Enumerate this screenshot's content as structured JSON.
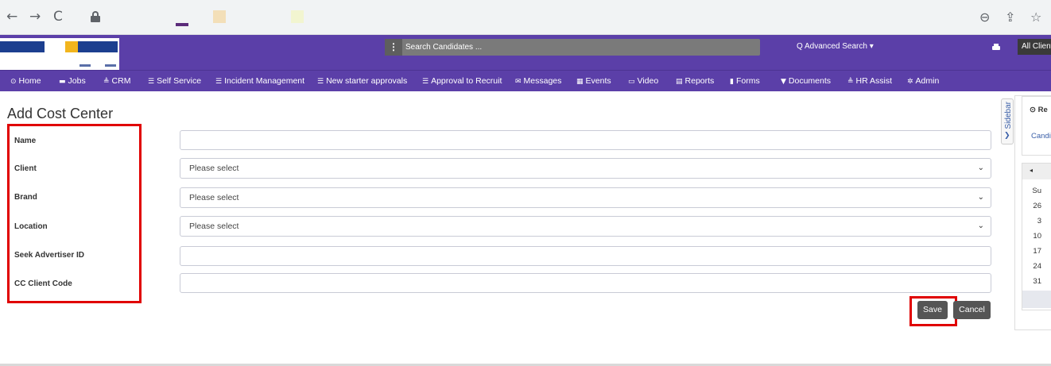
{
  "browser": {
    "back_glyph": "←",
    "forward_glyph": "→",
    "reload_glyph": "C",
    "zoom_glyph": "⊖",
    "share_glyph": "⇪",
    "star_glyph": "☆",
    "swatch_colors": [
      "#5b2b7a",
      "#f3dfb8",
      "#f2f5d0"
    ]
  },
  "header": {
    "search_placeholder": "Search Candidates ...",
    "search_menu_glyph": "⋮",
    "advanced_search": "Q Advanced Search ▾",
    "all_clients": "All Clients",
    "brand_color": "#5b3fa8"
  },
  "nav": {
    "items": [
      {
        "icon": "home-icon",
        "glyph": "⊙",
        "label": "Home"
      },
      {
        "icon": "folder-icon",
        "glyph": "▬",
        "label": "Jobs"
      },
      {
        "icon": "crm-icon",
        "glyph": "≜",
        "label": "CRM"
      },
      {
        "icon": "list-icon",
        "glyph": "☰",
        "label": "Self Service"
      },
      {
        "icon": "list-icon",
        "glyph": "☰",
        "label": "Incident Management"
      },
      {
        "icon": "list-icon",
        "glyph": "☰",
        "label": "New starter approvals"
      },
      {
        "icon": "list-icon",
        "glyph": "☰",
        "label": "Approval to Recruit"
      },
      {
        "icon": "envelope-icon",
        "glyph": "✉",
        "label": "Messages"
      },
      {
        "icon": "calendar-icon",
        "glyph": "▦",
        "label": "Events"
      },
      {
        "icon": "video-icon",
        "glyph": "▭",
        "label": "Video"
      },
      {
        "icon": "reports-icon",
        "glyph": "▤",
        "label": "Reports"
      },
      {
        "icon": "file-icon",
        "glyph": "▮",
        "label": "Forms"
      },
      {
        "icon": "filter-icon",
        "glyph": "▼",
        "label": "Documents"
      },
      {
        "icon": "hr-icon",
        "glyph": "≜",
        "label": "HR Assist"
      },
      {
        "icon": "gear-icon",
        "glyph": "✲",
        "label": "Admin"
      }
    ]
  },
  "form": {
    "title": "Add Cost Center",
    "fields": [
      {
        "label": "Name",
        "value": ""
      },
      {
        "label": "Client",
        "value": "Please select"
      },
      {
        "label": "Brand",
        "value": "Please select"
      },
      {
        "label": "Location",
        "value": "Please select"
      },
      {
        "label": "Seek Advertiser ID",
        "value": ""
      },
      {
        "label": "CC Client Code",
        "value": ""
      }
    ],
    "save_label": "Save",
    "cancel_label": "Cancel",
    "highlight_color": "#e00000"
  },
  "sidebar": {
    "tab_label": "Sidebar",
    "tab_arrow": "❯",
    "panel_title": "⊙ Re",
    "panel_text": "Candi",
    "calendar": {
      "nav_glyph": "◂",
      "day_header": "Su",
      "days": [
        "26",
        "3",
        "10",
        "17",
        "24",
        "31"
      ]
    }
  }
}
